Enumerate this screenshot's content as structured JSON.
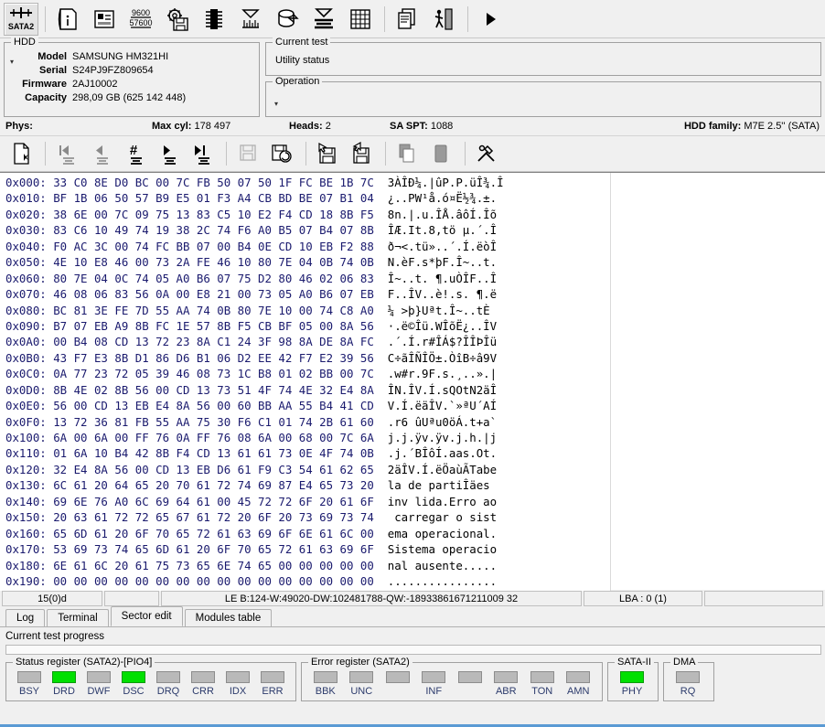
{
  "toolbar": {
    "buttons": [
      {
        "name": "sata2-mode-button",
        "icon": "sata2-port-icon",
        "label": "SATA2"
      },
      {
        "name": "drive-id-button",
        "icon": "document-info-icon",
        "label": ""
      },
      {
        "name": "drive-info-button",
        "icon": "drive-properties-icon",
        "label": ""
      },
      {
        "name": "baudrate-button",
        "icon": "baudrate-9600-57600-icon",
        "label": "9600 57600"
      },
      {
        "name": "loader-button",
        "icon": "gear-floppy-icon",
        "label": ""
      },
      {
        "name": "rom-button",
        "icon": "chip-icon",
        "label": ""
      },
      {
        "name": "scan-tests-button",
        "icon": "funnel-ruler-icon",
        "label": ""
      },
      {
        "name": "container-button",
        "icon": "drum-arrow-icon",
        "label": ""
      },
      {
        "name": "erase-button",
        "icon": "funnel-lines-icon",
        "label": ""
      },
      {
        "name": "grid-button",
        "icon": "grid-table-icon",
        "label": ""
      },
      {
        "name": "copy-pages-button",
        "icon": "copy-pages-icon",
        "label": ""
      },
      {
        "name": "walk-button",
        "icon": "person-door-icon",
        "label": ""
      },
      {
        "name": "run-button",
        "icon": "play-triangle-icon",
        "label": ""
      }
    ]
  },
  "hdd": {
    "group_title": "HDD",
    "rows": [
      {
        "label": "Model",
        "value": "SAMSUNG HM321HI"
      },
      {
        "label": "Serial",
        "value": "S24PJ9FZ809654"
      },
      {
        "label": "Firmware",
        "value": "2AJ10002"
      },
      {
        "label": "Capacity",
        "value": "298,09 GB (625 142 448)"
      }
    ]
  },
  "current_test": {
    "group_title": "Current test",
    "status": "Utility status"
  },
  "operation": {
    "group_title": "Operation",
    "value": ""
  },
  "phys": {
    "label": "Phys:",
    "max_cyl_label": "Max cyl:",
    "max_cyl_value": "178 497",
    "heads_label": "Heads:",
    "heads_value": "2",
    "sa_spt_label": "SA SPT:",
    "sa_spt_value": "1088",
    "family_label": "HDD family:",
    "family_value": "M7E 2.5'' (SATA)"
  },
  "sector_toolbar": {
    "buttons": [
      {
        "name": "new-sector-button",
        "icon": "page-star-icon"
      },
      {
        "name": "first-sector-button",
        "icon": "first-lines-icon"
      },
      {
        "name": "prev-sector-button",
        "icon": "prev-lines-icon"
      },
      {
        "name": "goto-sector-button",
        "icon": "hash-lines-icon"
      },
      {
        "name": "next-sector-button",
        "icon": "next-lines-icon"
      },
      {
        "name": "last-sector-button",
        "icon": "last-lines-icon"
      },
      {
        "name": "save-sector-button",
        "icon": "floppy-icon"
      },
      {
        "name": "load-sector-button",
        "icon": "floppy-refresh-icon"
      },
      {
        "name": "read-from-disk-button",
        "icon": "floppy-arrow-in-icon"
      },
      {
        "name": "write-to-disk-button",
        "icon": "floppy-arrow-out-icon"
      },
      {
        "name": "copy-button",
        "icon": "copy-icon"
      },
      {
        "name": "paste-button",
        "icon": "paste-icon"
      },
      {
        "name": "tools-button",
        "icon": "hammer-wrench-icon"
      }
    ]
  },
  "hex": {
    "lines": [
      {
        "offset": "0x000:",
        "bytes": "33 C0 8E D0 BC 00 7C FB 50 07 50 1F FC BE 1B 7C",
        "ascii": "3ÀÎÐ¼.|ûP.P.üÎ¾.Î"
      },
      {
        "offset": "0x010:",
        "bytes": "BF 1B 06 50 57 B9 E5 01 F3 A4 CB BD BE 07 B1 04",
        "ascii": "¿..PW¹å.ó¤Ë½¾.±."
      },
      {
        "offset": "0x020:",
        "bytes": "38 6E 00 7C 09 75 13 83 C5 10 E2 F4 CD 18 8B F5",
        "ascii": "8n.|.u.ÎÅ.âôÍ.Îõ"
      },
      {
        "offset": "0x030:",
        "bytes": "83 C6 10 49 74 19 38 2C 74 F6 A0 B5 07 B4 07 8B",
        "ascii": "ÎÆ.It.8,tö µ.´.Î"
      },
      {
        "offset": "0x040:",
        "bytes": "F0 AC 3C 00 74 FC BB 07 00 B4 0E CD 10 EB F2 88",
        "ascii": "ð¬<.tü»..´.Í.ëòÎ"
      },
      {
        "offset": "0x050:",
        "bytes": "4E 10 E8 46 00 73 2A FE 46 10 80 7E 04 0B 74 0B",
        "ascii": "N.èF.s*þF.Î~..t."
      },
      {
        "offset": "0x060:",
        "bytes": "80 7E 04 0C 74 05 A0 B6 07 75 D2 80 46 02 06 83",
        "ascii": "Î~..t. ¶.uÒÎF..Î"
      },
      {
        "offset": "0x070:",
        "bytes": "46 08 06 83 56 0A 00 E8 21 00 73 05 A0 B6 07 EB",
        "ascii": "F..ÎV..è!.s. ¶.ë"
      },
      {
        "offset": "0x080:",
        "bytes": "BC 81 3E FE 7D 55 AA 74 0B 80 7E 10 00 74 C8 A0",
        "ascii": "¼ >þ}Uªt.Î~..tÈ "
      },
      {
        "offset": "0x090:",
        "bytes": "B7 07 EB A9 8B FC 1E 57 8B F5 CB BF 05 00 8A 56",
        "ascii": "·.ë©Îü.WÎõË¿..ÎV"
      },
      {
        "offset": "0x0A0:",
        "bytes": "00 B4 08 CD 13 72 23 8A C1 24 3F 98 8A DE 8A FC",
        "ascii": ".´.Í.r#ÎÁ$?ÎÎÞÎü"
      },
      {
        "offset": "0x0B0:",
        "bytes": "43 F7 E3 8B D1 86 D6 B1 06 D2 EE 42 F7 E2 39 56",
        "ascii": "C÷ãÎÑÎÖ±.ÒîB÷â9V"
      },
      {
        "offset": "0x0C0:",
        "bytes": "0A 77 23 72 05 39 46 08 73 1C B8 01 02 BB 00 7C",
        "ascii": ".w#r.9F.s.¸..».|"
      },
      {
        "offset": "0x0D0:",
        "bytes": "8B 4E 02 8B 56 00 CD 13 73 51 4F 74 4E 32 E4 8A",
        "ascii": "ÎN.ÎV.Í.sQOtN2äÎ"
      },
      {
        "offset": "0x0E0:",
        "bytes": "56 00 CD 13 EB E4 8A 56 00 60 BB AA 55 B4 41 CD",
        "ascii": "V.Í.ëäÎV.`»ªU´AÍ"
      },
      {
        "offset": "0x0F0:",
        "bytes": "13 72 36 81 FB 55 AA 75 30 F6 C1 01 74 2B 61 60",
        "ascii": ".r6 ûUªu0öÁ.t+a`"
      },
      {
        "offset": "0x100:",
        "bytes": "6A 00 6A 00 FF 76 0A FF 76 08 6A 00 68 00 7C 6A",
        "ascii": "j.j.ÿv.ÿv.j.h.|j"
      },
      {
        "offset": "0x110:",
        "bytes": "01 6A 10 B4 42 8B F4 CD 13 61 61 73 0E 4F 74 0B",
        "ascii": ".j.´BÎôÍ.aas.Ot."
      },
      {
        "offset": "0x120:",
        "bytes": "32 E4 8A 56 00 CD 13 EB D6 61 F9 C3 54 61 62 65",
        "ascii": "2äÎV.Í.ëÖaùÃTabe"
      },
      {
        "offset": "0x130:",
        "bytes": "6C 61 20 64 65 20 70 61 72 74 69 87 E4 65 73 20",
        "ascii": "la de partiÎäes "
      },
      {
        "offset": "0x140:",
        "bytes": "69 6E 76 A0 6C 69 64 61 00 45 72 72 6F 20 61 6F",
        "ascii": "inv lida.Erro ao"
      },
      {
        "offset": "0x150:",
        "bytes": "20 63 61 72 72 65 67 61 72 20 6F 20 73 69 73 74",
        "ascii": " carregar o sist"
      },
      {
        "offset": "0x160:",
        "bytes": "65 6D 61 20 6F 70 65 72 61 63 69 6F 6E 61 6C 00",
        "ascii": "ema operacional."
      },
      {
        "offset": "0x170:",
        "bytes": "53 69 73 74 65 6D 61 20 6F 70 65 72 61 63 69 6F",
        "ascii": "Sistema operacio"
      },
      {
        "offset": "0x180:",
        "bytes": "6E 61 6C 20 61 75 73 65 6E 74 65 00 00 00 00 00",
        "ascii": "nal ausente....."
      },
      {
        "offset": "0x190:",
        "bytes": "00 00 00 00 00 00 00 00 00 00 00 00 00 00 00 00",
        "ascii": "................"
      }
    ]
  },
  "lower_status": {
    "cell1": "15(0)d",
    "cell2": "",
    "cell3": "LE B:124-W:49020-DW:102481788-QW:-18933861671211009 32",
    "cell4": "LBA : 0 (1)",
    "cell5": ""
  },
  "tabs": [
    {
      "name": "tab-log",
      "label": "Log",
      "active": false
    },
    {
      "name": "tab-terminal",
      "label": "Terminal",
      "active": false
    },
    {
      "name": "tab-sector-edit",
      "label": "Sector edit",
      "active": true
    },
    {
      "name": "tab-modules-table",
      "label": "Modules table",
      "active": false
    }
  ],
  "progress": {
    "label": "Current test progress",
    "percent": 0
  },
  "registers": {
    "status": {
      "title": "Status register (SATA2)-[PIO4]",
      "leds": [
        {
          "label": "BSY",
          "on": false
        },
        {
          "label": "DRD",
          "on": true
        },
        {
          "label": "DWF",
          "on": false
        },
        {
          "label": "DSC",
          "on": true
        },
        {
          "label": "DRQ",
          "on": false
        },
        {
          "label": "CRR",
          "on": false
        },
        {
          "label": "IDX",
          "on": false
        },
        {
          "label": "ERR",
          "on": false
        }
      ]
    },
    "error": {
      "title": "Error register (SATA2)",
      "leds": [
        {
          "label": "BBK",
          "on": false
        },
        {
          "label": "UNC",
          "on": false
        },
        {
          "label": "",
          "on": false
        },
        {
          "label": "INF",
          "on": false
        },
        {
          "label": "",
          "on": false
        },
        {
          "label": "ABR",
          "on": false
        },
        {
          "label": "TON",
          "on": false
        },
        {
          "label": "AMN",
          "on": false
        }
      ]
    },
    "sata": {
      "title": "SATA-II",
      "leds": [
        {
          "label": "PHY",
          "on": true
        }
      ]
    },
    "dma": {
      "title": "DMA",
      "leds": [
        {
          "label": "RQ",
          "on": false
        }
      ]
    }
  },
  "colors": {
    "led_on": "#00e000",
    "led_off": "#b9b9b9",
    "hex_text": "#1a1a6e",
    "accent_bar": "#5a9ad4"
  }
}
